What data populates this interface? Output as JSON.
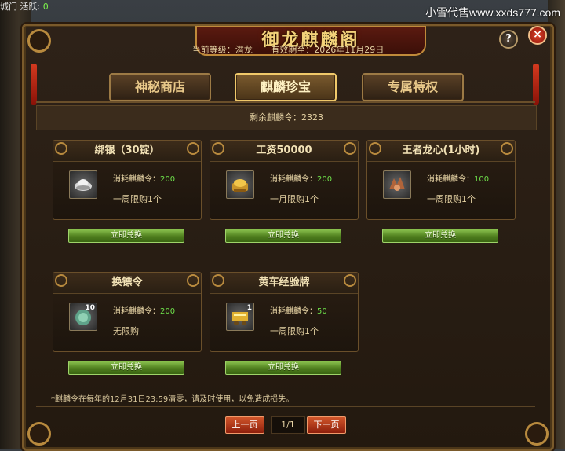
{
  "hud": {
    "label": "城门 活跃:",
    "value": "0"
  },
  "watermark": "小雪代售www.xxds777.com",
  "window": {
    "title": "御龙麒麟阁",
    "help_label": "?",
    "close_label": "×"
  },
  "status": {
    "level_label": "当前等级：潜龙",
    "expiry_label": "有效期至：2026年11月29日"
  },
  "tabs": [
    {
      "label": "神秘商店",
      "active": false
    },
    {
      "label": "麒麟珍宝",
      "active": true
    },
    {
      "label": "专属特权",
      "active": false
    }
  ],
  "remaining": "剩余麒麟令：2323",
  "items": [
    {
      "name": "绑银（30锭）",
      "cost_label": "消耗麒麟令：",
      "cost": "200",
      "limit": "一周限购1个",
      "icon": "silver-ingot-icon",
      "count": "",
      "button": "立即兑换"
    },
    {
      "name": "工资50000",
      "cost_label": "消耗麒麟令：",
      "cost": "200",
      "limit": "一月限购1个",
      "icon": "gold-ingot-icon",
      "count": "",
      "button": "立即兑换"
    },
    {
      "name": "王者龙心(1小时)",
      "cost_label": "消耗麒麟令：",
      "cost": "100",
      "limit": "一周限购1个",
      "icon": "dragon-heart-icon",
      "count": "",
      "button": "立即兑换"
    },
    {
      "name": "换镖令",
      "cost_label": "消耗麒麟令：",
      "cost": "200",
      "limit": "无限购",
      "icon": "escort-token-icon",
      "count": "10",
      "button": "立即兑换"
    },
    {
      "name": "黄车经验牌",
      "cost_label": "消耗麒麟令：",
      "cost": "50",
      "limit": "一周限购1个",
      "icon": "yellow-cart-plaque-icon",
      "count": "1",
      "button": "立即兑换"
    }
  ],
  "note": "*麒麟令在每年的12月31日23:59清零，请及时使用，以免造成损失。",
  "pager": {
    "prev": "上一页",
    "current": "1/1",
    "next": "下一页"
  },
  "colors": {
    "accent_gold": "#f0c96a",
    "cost_green": "#6ee04a",
    "button_green": "#6aa234",
    "pager_red": "#c0401e",
    "close_red": "#e2452c"
  }
}
